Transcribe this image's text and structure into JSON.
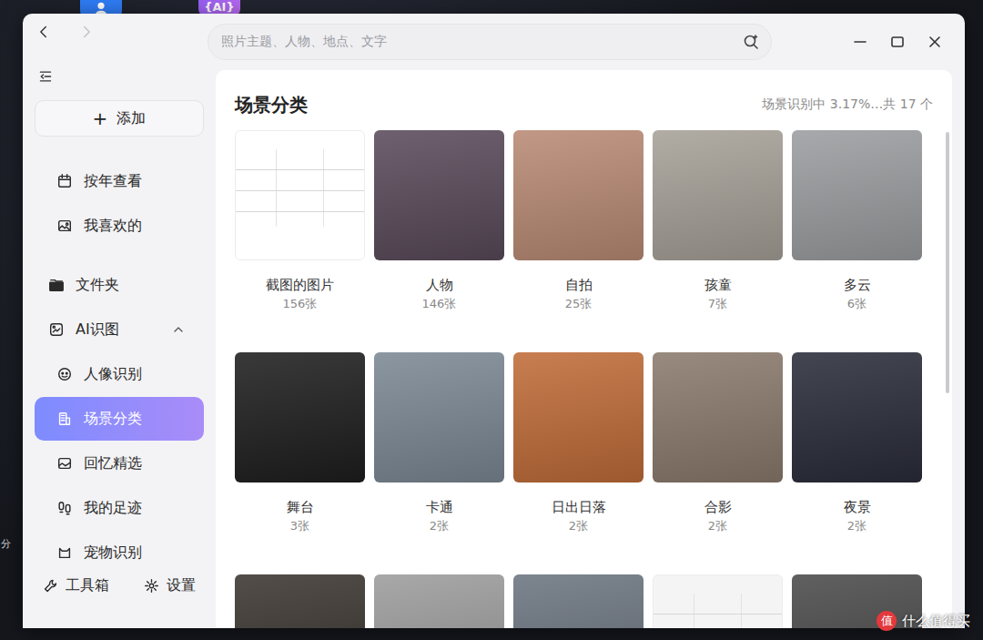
{
  "desktop": {
    "app_badge": "{AI}",
    "edge_text": "分"
  },
  "window": {
    "nav": {
      "back_disabled": false,
      "forward_disabled": true
    },
    "search": {
      "placeholder": "照片主题、人物、地点、文字"
    }
  },
  "sidebar": {
    "add": {
      "icon": "+",
      "label": "添加"
    },
    "items": [
      {
        "label": "按年查看",
        "kind": "item",
        "selected": false
      },
      {
        "label": "我喜欢的",
        "kind": "item",
        "selected": false
      },
      {
        "label": "文件夹",
        "kind": "section",
        "selected": false
      },
      {
        "label": "AI识图",
        "kind": "group",
        "expanded": true,
        "selected": false
      },
      {
        "label": "人像识别",
        "kind": "sub",
        "selected": false
      },
      {
        "label": "场景分类",
        "kind": "sub",
        "selected": true
      },
      {
        "label": "回忆精选",
        "kind": "sub",
        "selected": false
      },
      {
        "label": "我的足迹",
        "kind": "sub",
        "selected": false
      },
      {
        "label": "宠物识别",
        "kind": "sub",
        "selected": false
      }
    ],
    "footer": [
      {
        "label": "工具箱"
      },
      {
        "label": "设置"
      }
    ]
  },
  "main": {
    "title": "场景分类",
    "status": "场景识别中 3.17%…共 17 个",
    "albums": [
      {
        "label": "截图的图片",
        "count": "156张",
        "kind": "document",
        "color": "#ffffff"
      },
      {
        "label": "人物",
        "count": "146张",
        "kind": "photo",
        "color": "#5a4a5a"
      },
      {
        "label": "自拍",
        "count": "25张",
        "kind": "photo",
        "color": "#b98a74"
      },
      {
        "label": "孩童",
        "count": "7张",
        "kind": "photo",
        "color": "#a6a198"
      },
      {
        "label": "多云",
        "count": "6张",
        "kind": "photo",
        "color": "#9b9da0"
      },
      {
        "label": "舞台",
        "count": "3张",
        "kind": "photo",
        "color": "#1e1e1e"
      },
      {
        "label": "卡通",
        "count": "2张",
        "kind": "photo",
        "color": "#7b8894"
      },
      {
        "label": "日出日落",
        "count": "2张",
        "kind": "photo",
        "color": "#c06c38"
      },
      {
        "label": "合影",
        "count": "2张",
        "kind": "photo",
        "color": "#8a7a6c"
      },
      {
        "label": "夜景",
        "count": "2张",
        "kind": "photo",
        "color": "#2a2c3a"
      }
    ],
    "more_albums": [
      {
        "kind": "photo",
        "color": "#3a3530"
      },
      {
        "kind": "photo",
        "color": "#9c9c9c"
      },
      {
        "kind": "photo",
        "color": "#6b7480"
      },
      {
        "kind": "document",
        "color": "#f4f4f4"
      },
      {
        "kind": "photo",
        "color": "#4a4a4a"
      }
    ]
  },
  "watermark": {
    "logo": "值",
    "text": "什么值得买"
  }
}
